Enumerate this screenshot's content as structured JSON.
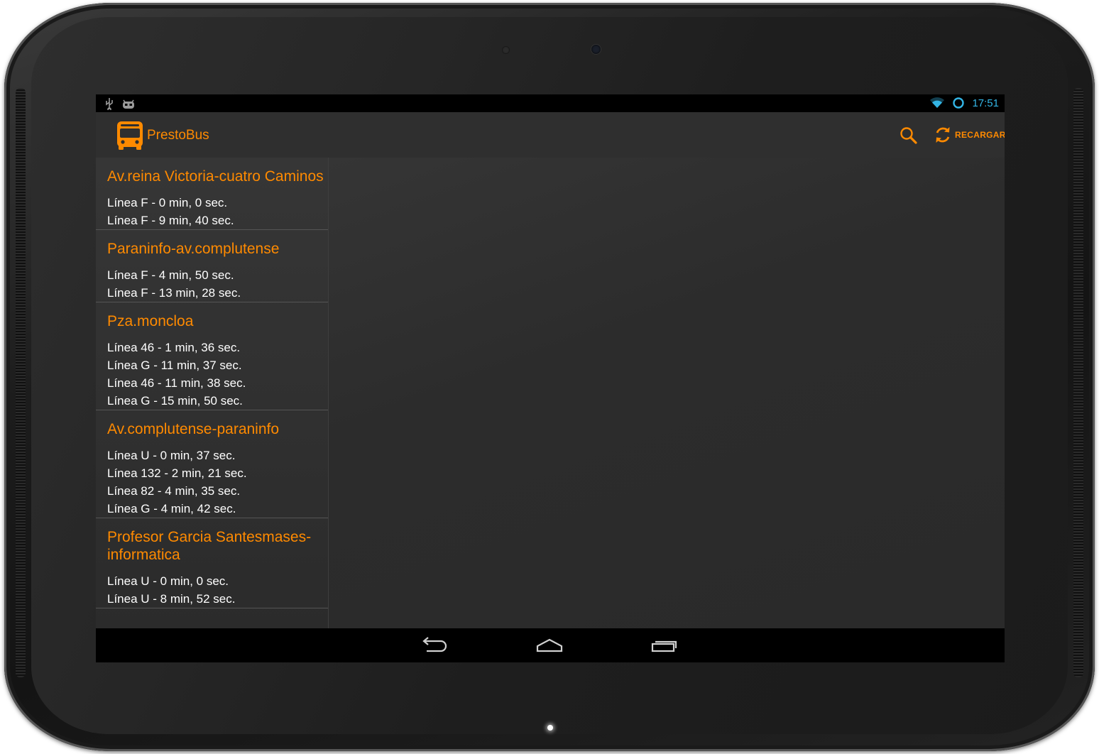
{
  "status_bar": {
    "time": "17:51"
  },
  "app": {
    "title": "PrestoBus"
  },
  "actions": {
    "reload_label": "RECARGAR"
  },
  "stops": [
    {
      "name": "Av.reina Victoria-cuatro Caminos",
      "arrivals": [
        "Línea F - 0 min, 0 sec.",
        "Línea F - 9 min, 40 sec."
      ]
    },
    {
      "name": "Paraninfo-av.complutense",
      "arrivals": [
        "Línea F - 4 min, 50 sec.",
        "Línea F - 13 min, 28 sec."
      ]
    },
    {
      "name": "Pza.moncloa",
      "arrivals": [
        "Línea 46 - 1 min, 36 sec.",
        "Línea G - 11 min, 37 sec.",
        "Línea 46 - 11 min, 38 sec.",
        "Línea G - 15 min, 50 sec."
      ]
    },
    {
      "name": "Av.complutense-paraninfo",
      "arrivals": [
        "Línea U - 0 min, 37 sec.",
        "Línea 132 - 2 min, 21 sec.",
        "Línea 82 - 4 min, 35 sec.",
        "Línea G - 4 min, 42 sec."
      ]
    },
    {
      "name": "Profesor Garcia Santesmases-informatica",
      "arrivals": [
        "Línea U - 0 min, 0 sec.",
        "Línea U - 8 min, 52 sec."
      ]
    }
  ],
  "colors": {
    "accent": "#ff8a00",
    "clock": "#33b5e5",
    "background": "#2e2e2e"
  },
  "icons": {
    "status_left": [
      "usb-icon",
      "debug-android-icon"
    ],
    "status_right": [
      "wifi-icon",
      "sync-icon"
    ],
    "actionbar": [
      "bus-icon",
      "search-icon",
      "refresh-icon"
    ],
    "navbar": [
      "back-icon",
      "home-icon",
      "recents-icon"
    ]
  }
}
